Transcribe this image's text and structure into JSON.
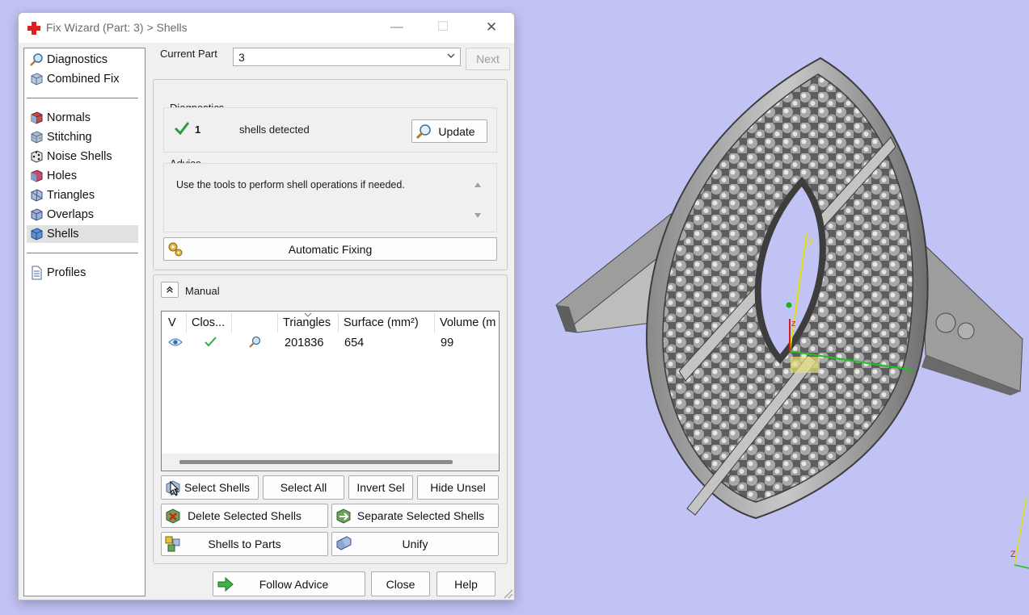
{
  "window": {
    "title": "Fix Wizard (Part: 3) > Shells",
    "minimize": "—",
    "maximize": "☐",
    "close": "✕"
  },
  "nav": {
    "group1": [
      {
        "label": "Diagnostics",
        "icon": "magnifier-icon"
      },
      {
        "label": "Combined Fix",
        "icon": "cube-icon"
      }
    ],
    "group2": [
      {
        "label": "Normals",
        "icon": "normals-cube-icon"
      },
      {
        "label": "Stitching",
        "icon": "stitching-cube-icon"
      },
      {
        "label": "Noise Shells",
        "icon": "noise-cube-icon"
      },
      {
        "label": "Holes",
        "icon": "holes-cube-icon"
      },
      {
        "label": "Triangles",
        "icon": "triangles-cube-icon"
      },
      {
        "label": "Overlaps",
        "icon": "overlaps-cube-icon"
      },
      {
        "label": "Shells",
        "icon": "shells-cube-icon",
        "selected": true
      }
    ],
    "group3": [
      {
        "label": "Profiles",
        "icon": "document-icon"
      }
    ]
  },
  "current_part": {
    "label": "Current Part",
    "value": "3",
    "next_label": "Next"
  },
  "diagnostics": {
    "title": "Diagnostics",
    "count": "1",
    "text": "shells detected",
    "update_label": "Update"
  },
  "advice": {
    "title": "Advice",
    "text": "Use the tools to perform shell operations if needed."
  },
  "automatic_fixing": "Automatic Fixing",
  "manual": {
    "title": "Manual",
    "columns": [
      "V",
      "Clos...",
      "",
      "Triangles",
      "Surface (mm²)",
      "Volume (m"
    ],
    "rows": [
      {
        "triangles": "201836",
        "surface": "654",
        "volume": "99"
      }
    ],
    "buttons": {
      "select_shells": "Select Shells",
      "select_all": "Select All",
      "invert_sel": "Invert Sel",
      "hide_unsel": "Hide Unsel",
      "delete_selected": "Delete Selected Shells",
      "separate_selected": "Separate Selected Shells",
      "shells_to_parts": "Shells to Parts",
      "unify": "Unify"
    }
  },
  "footer": {
    "follow_advice": "Follow Advice",
    "close": "Close",
    "help": "Help"
  },
  "viewport": {
    "axis_y": "y",
    "axis_z": "z",
    "axis_x": "x",
    "corner_axis": "Z",
    "background": "#c2c3f5"
  }
}
